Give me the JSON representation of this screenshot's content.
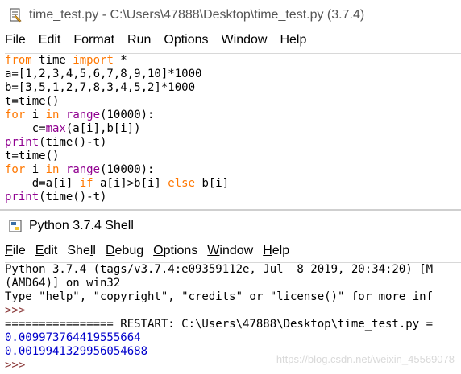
{
  "editor": {
    "title": "time_test.py - C:\\Users\\47888\\Desktop\\time_test.py (3.7.4)",
    "menu": [
      "File",
      "Edit",
      "Format",
      "Run",
      "Options",
      "Window",
      "Help"
    ],
    "code": [
      [
        {
          "t": "from",
          "c": "kw"
        },
        {
          "t": " time ",
          "c": ""
        },
        {
          "t": "import",
          "c": "kw"
        },
        {
          "t": " *",
          "c": ""
        }
      ],
      [
        {
          "t": "a=[1,2,3,4,5,6,7,8,9,10]*1000",
          "c": ""
        }
      ],
      [
        {
          "t": "b=[3,5,1,2,7,8,3,4,5,2]*1000",
          "c": ""
        }
      ],
      [
        {
          "t": "t=time()",
          "c": ""
        }
      ],
      [
        {
          "t": "for",
          "c": "kw"
        },
        {
          "t": " i ",
          "c": ""
        },
        {
          "t": "in",
          "c": "kw"
        },
        {
          "t": " ",
          "c": ""
        },
        {
          "t": "range",
          "c": "bi"
        },
        {
          "t": "(10000):",
          "c": ""
        }
      ],
      [
        {
          "t": "    c=",
          "c": ""
        },
        {
          "t": "max",
          "c": "bi"
        },
        {
          "t": "(a[i],b[i])",
          "c": ""
        }
      ],
      [
        {
          "t": "print",
          "c": "bi"
        },
        {
          "t": "(time()-t)",
          "c": ""
        }
      ],
      [
        {
          "t": "t=time()",
          "c": ""
        }
      ],
      [
        {
          "t": "for",
          "c": "kw"
        },
        {
          "t": " i ",
          "c": ""
        },
        {
          "t": "in",
          "c": "kw"
        },
        {
          "t": " ",
          "c": ""
        },
        {
          "t": "range",
          "c": "bi"
        },
        {
          "t": "(10000):",
          "c": ""
        }
      ],
      [
        {
          "t": "    d=a[i] ",
          "c": ""
        },
        {
          "t": "if",
          "c": "kw"
        },
        {
          "t": " a[i]>b[i] ",
          "c": ""
        },
        {
          "t": "else",
          "c": "kw"
        },
        {
          "t": " b[i]",
          "c": ""
        }
      ],
      [
        {
          "t": "print",
          "c": "bi"
        },
        {
          "t": "(time()-t)",
          "c": ""
        }
      ]
    ]
  },
  "shell": {
    "title": "Python 3.7.4 Shell",
    "menu": [
      {
        "label": "File",
        "mn": 0
      },
      {
        "label": "Edit",
        "mn": 0
      },
      {
        "label": "Shell",
        "mn": 3
      },
      {
        "label": "Debug",
        "mn": 0
      },
      {
        "label": "Options",
        "mn": 0
      },
      {
        "label": "Window",
        "mn": 0
      },
      {
        "label": "Help",
        "mn": 0
      }
    ],
    "lines": [
      {
        "t": "Python 3.7.4 (tags/v3.7.4:e09359112e, Jul  8 2019, 20:34:20) [M",
        "c": ""
      },
      {
        "t": "(AMD64)] on win32",
        "c": ""
      },
      {
        "t": "Type \"help\", \"copyright\", \"credits\" or \"license()\" for more inf",
        "c": ""
      },
      {
        "t": ">>> ",
        "c": "prompt"
      },
      {
        "t": "================ RESTART: C:\\Users\\47888\\Desktop\\time_test.py =",
        "c": ""
      },
      {
        "t": "0.009973764419555664",
        "c": "out"
      },
      {
        "t": "0.0019941329956054688",
        "c": "out"
      },
      {
        "t": ">>> ",
        "c": "prompt"
      }
    ]
  },
  "watermark": "https://blog.csdn.net/weixin_45569078",
  "colors": {
    "keyword": "#ff7700",
    "builtin": "#900090",
    "output": "#0000cc",
    "prompt": "#8b3a3a"
  },
  "icons": {
    "editor": "idle-editor-icon",
    "shell": "python-shell-icon"
  }
}
